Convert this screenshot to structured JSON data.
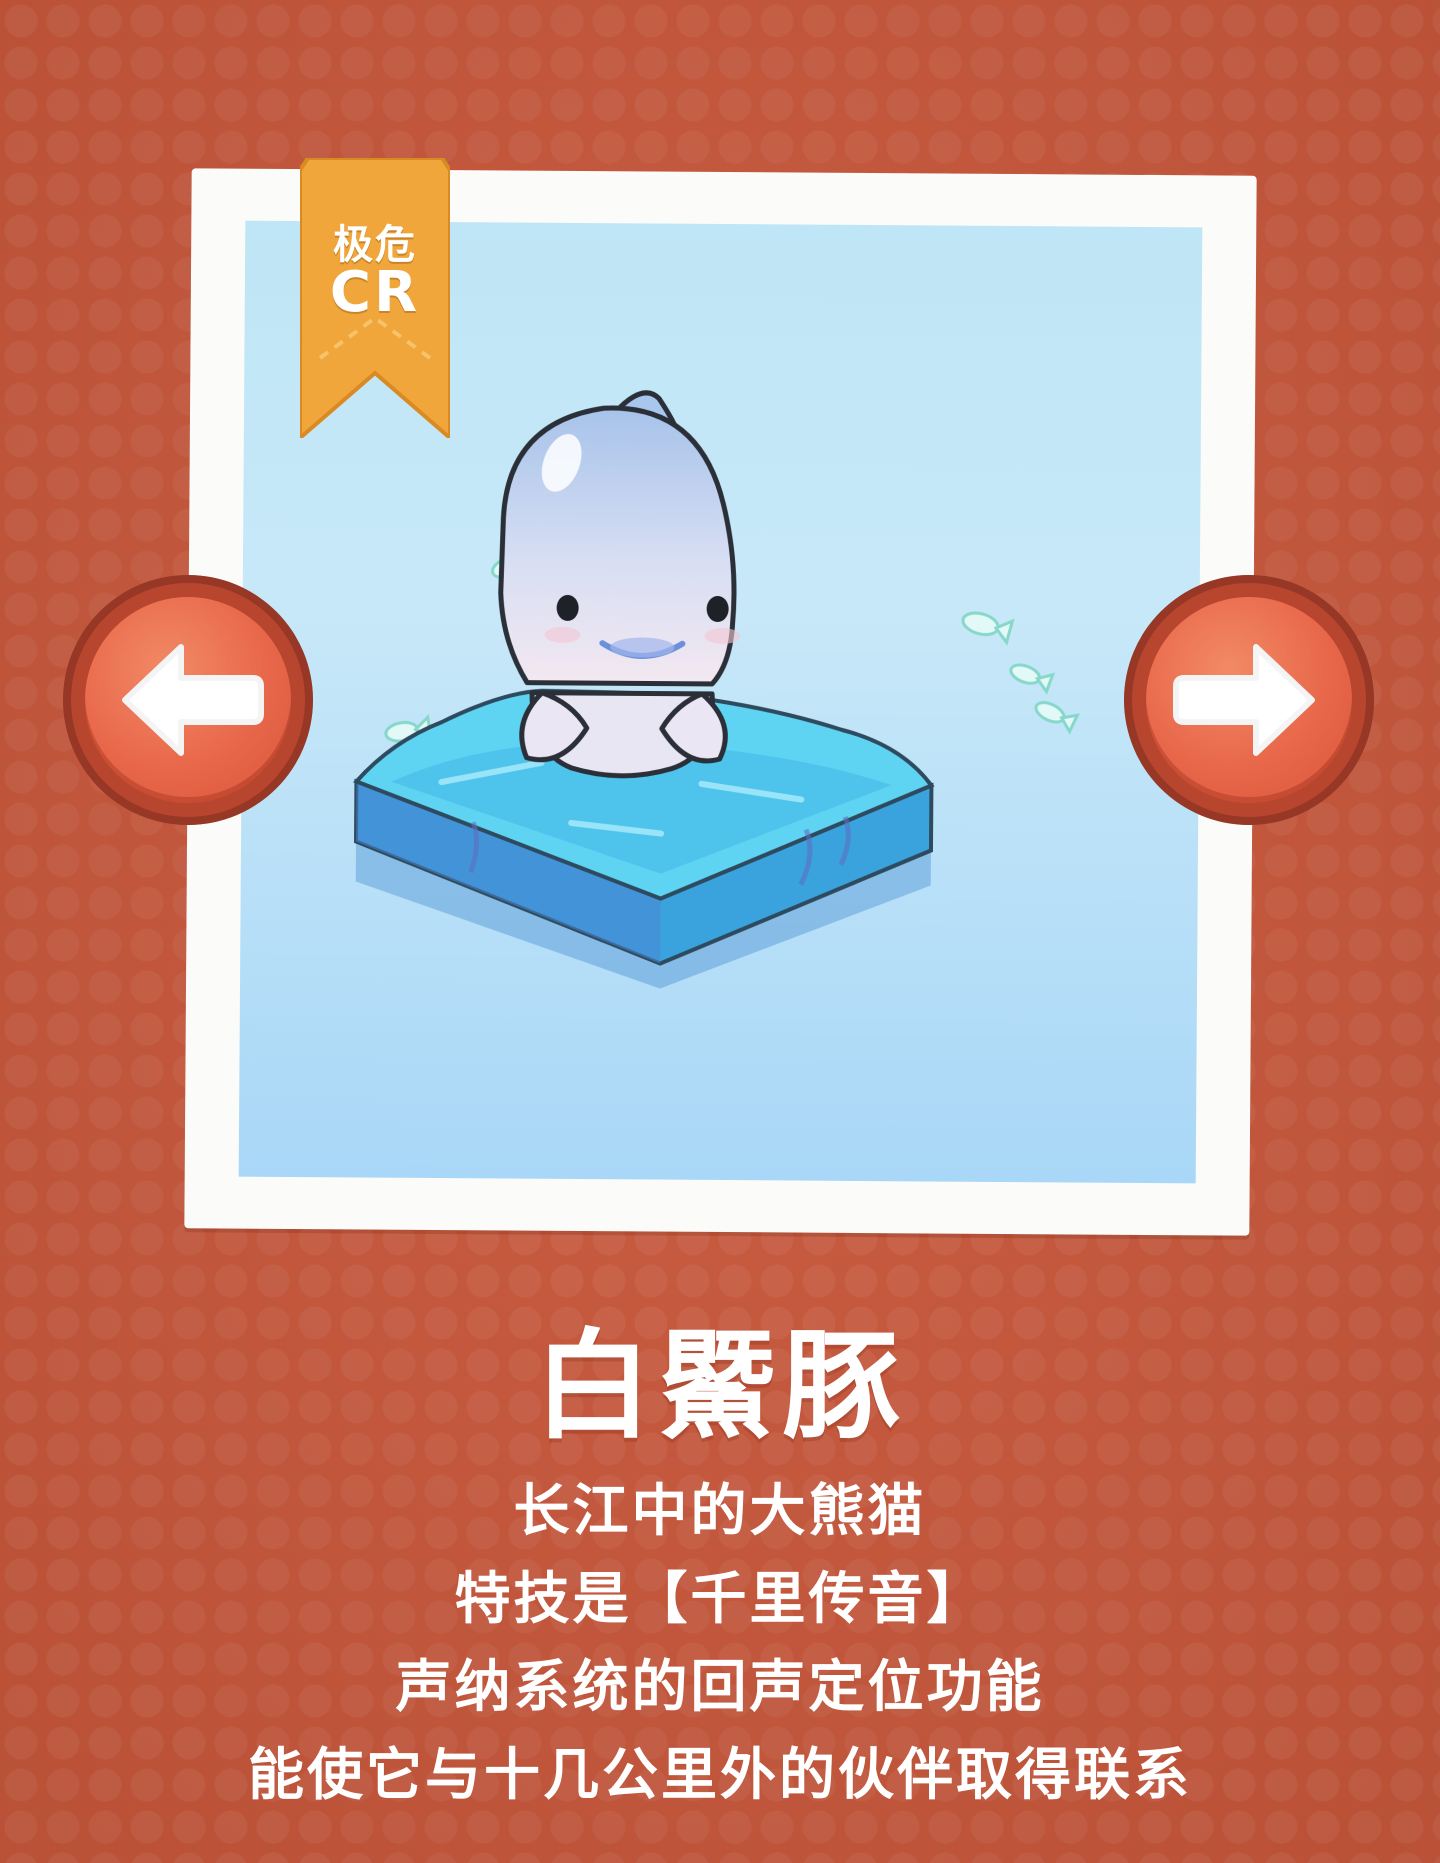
{
  "badge": {
    "level": "极危",
    "code": "CR"
  },
  "animal": {
    "name": "白鱀豚",
    "description": [
      "长江中的大熊猫",
      "特技是【千里传音】",
      "声纳系统的回声定位功能",
      "能使它与十几公里外的伙伴取得联系"
    ]
  },
  "nav": {
    "prev_icon": "arrow-left-icon",
    "next_icon": "arrow-right-icon"
  },
  "colors": {
    "background": "#c9583c",
    "ribbon": "#f0a63a",
    "button": "#e8674a",
    "water": "#3fb8e8"
  }
}
